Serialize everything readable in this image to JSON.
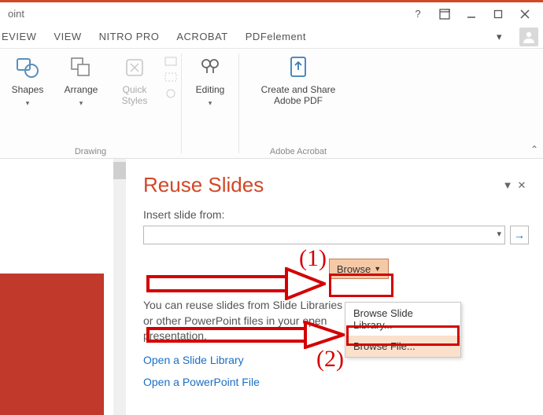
{
  "titlebar": {
    "app_fragment": "oint"
  },
  "tabs": {
    "review": "EVIEW",
    "view": "VIEW",
    "nitro": "NITRO PRO",
    "acrobat": "ACROBAT",
    "pdfelement": "PDFelement"
  },
  "ribbon": {
    "shapes": "Shapes",
    "arrange": "Arrange",
    "quick_styles": "Quick\nStyles",
    "drawing_group": "Drawing",
    "editing": "Editing",
    "create_share": "Create and Share\nAdobe PDF",
    "acrobat_group": "Adobe Acrobat"
  },
  "pane": {
    "title": "Reuse Slides",
    "insert_label": "Insert slide from:",
    "browse": "Browse",
    "info": "You can reuse slides from Slide Libraries or other PowerPoint files in your open presentation.",
    "link1": "Open a Slide Library",
    "link2": "Open a PowerPoint File"
  },
  "menu": {
    "item1": "Browse Slide Library...",
    "item2": "Browse File..."
  },
  "annotations": {
    "n1": "(1)",
    "n2": "(2)"
  }
}
